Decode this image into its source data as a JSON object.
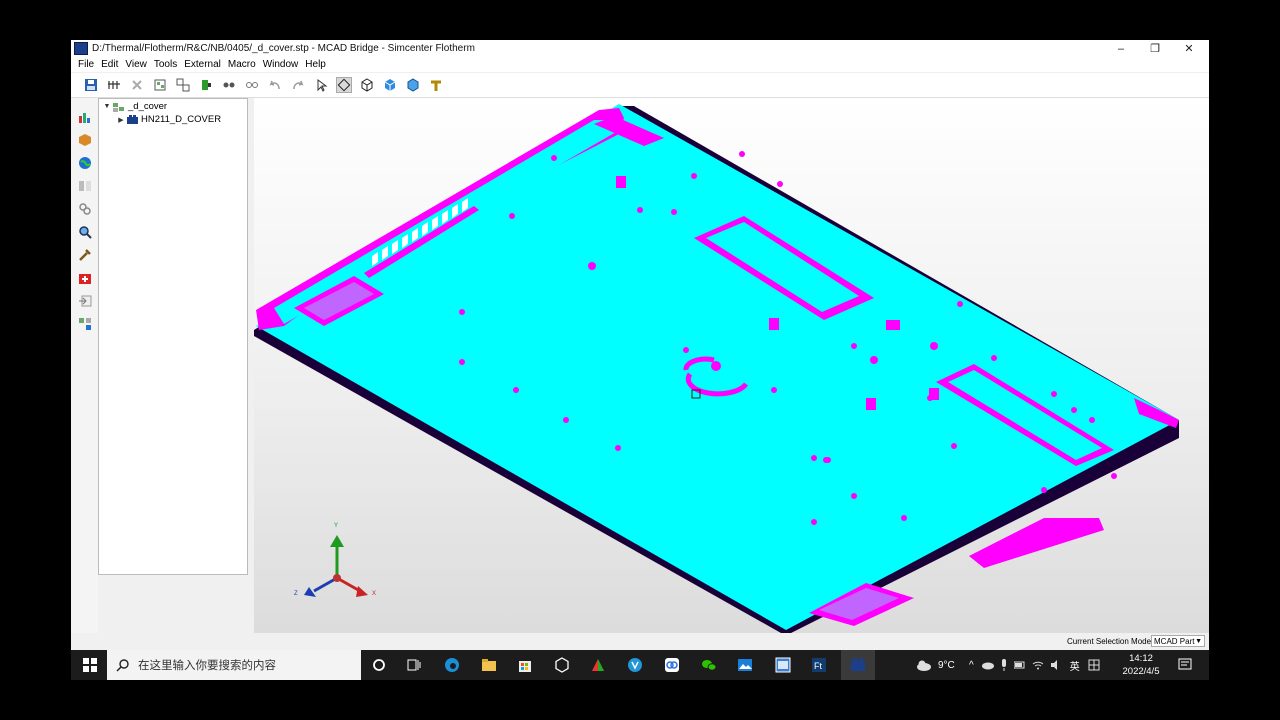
{
  "window": {
    "title": "D:/Thermal/Flotherm/R&C/NB/0405/_d_cover.stp - MCAD Bridge - Simcenter Flotherm",
    "minimize_glyph": "–",
    "restore_glyph": "❐",
    "close_glyph": "✕"
  },
  "menu": [
    "File",
    "Edit",
    "View",
    "Tools",
    "External",
    "Macro",
    "Window",
    "Help"
  ],
  "tree": {
    "root": "_d_cover",
    "child": "HN211_D_COVER"
  },
  "status": {
    "mode_label": "Current Selection Mode",
    "mode_value": "MCAD Part"
  },
  "axes": {
    "y": "Y",
    "z": "Z",
    "x": "X"
  },
  "taskbar": {
    "search_placeholder": "在这里输入你要搜索的内容",
    "weather": "9°C",
    "ime": "英",
    "time": "14:12",
    "date": "2022/4/5"
  },
  "colors": {
    "model_face": "#00ffff",
    "model_edge": "#ff00ff",
    "outline": "#1a0038"
  }
}
